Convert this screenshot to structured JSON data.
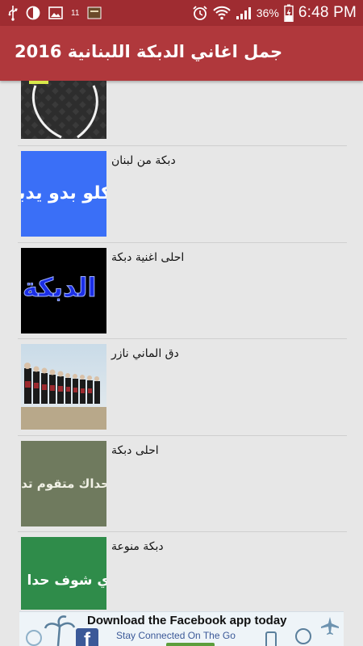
{
  "status_bar": {
    "time": "6:48 PM",
    "battery_percent": "36%",
    "signal_note": "11",
    "icons": [
      "usb-icon",
      "do-not-disturb-icon",
      "image-icon",
      "signal-strength-11-icon",
      "notification-icon",
      "alarm-icon",
      "wifi-icon",
      "cell-signal-icon",
      "battery-charging-icon"
    ]
  },
  "app_bar": {
    "title": "جمل اغاني الدبكة اللبنانية 2016"
  },
  "list": {
    "items": [
      {
        "label": "",
        "thumb": "earphones-image"
      },
      {
        "label": "دبكة من لبنان",
        "thumb": "blue-text-image",
        "thumb_text": "كلو بدو يدبك"
      },
      {
        "label": "احلى اغنية دبكة",
        "thumb": "black-blue-calligraphy-image",
        "thumb_text": "الدبكة"
      },
      {
        "label": "دق الماني نازر",
        "thumb": "dancers-photo"
      },
      {
        "label": "احلى دبكة",
        "thumb": "olive-text-image",
        "thumb_text": "حداك متقوم تدبك"
      },
      {
        "label": "دبكة منوعة",
        "thumb": "green-text-image",
        "thumb_text": "ي شوف حدا"
      }
    ]
  },
  "ad_banner": {
    "title": "Download the Facebook app today",
    "subtitle": "Stay Connected On The Go",
    "fb_glyph": "f"
  },
  "colors": {
    "status_bar": "#9f2c31",
    "app_bar": "#b0383c",
    "list_background": "#e7e7e7",
    "divider": "#cfcfcf"
  }
}
